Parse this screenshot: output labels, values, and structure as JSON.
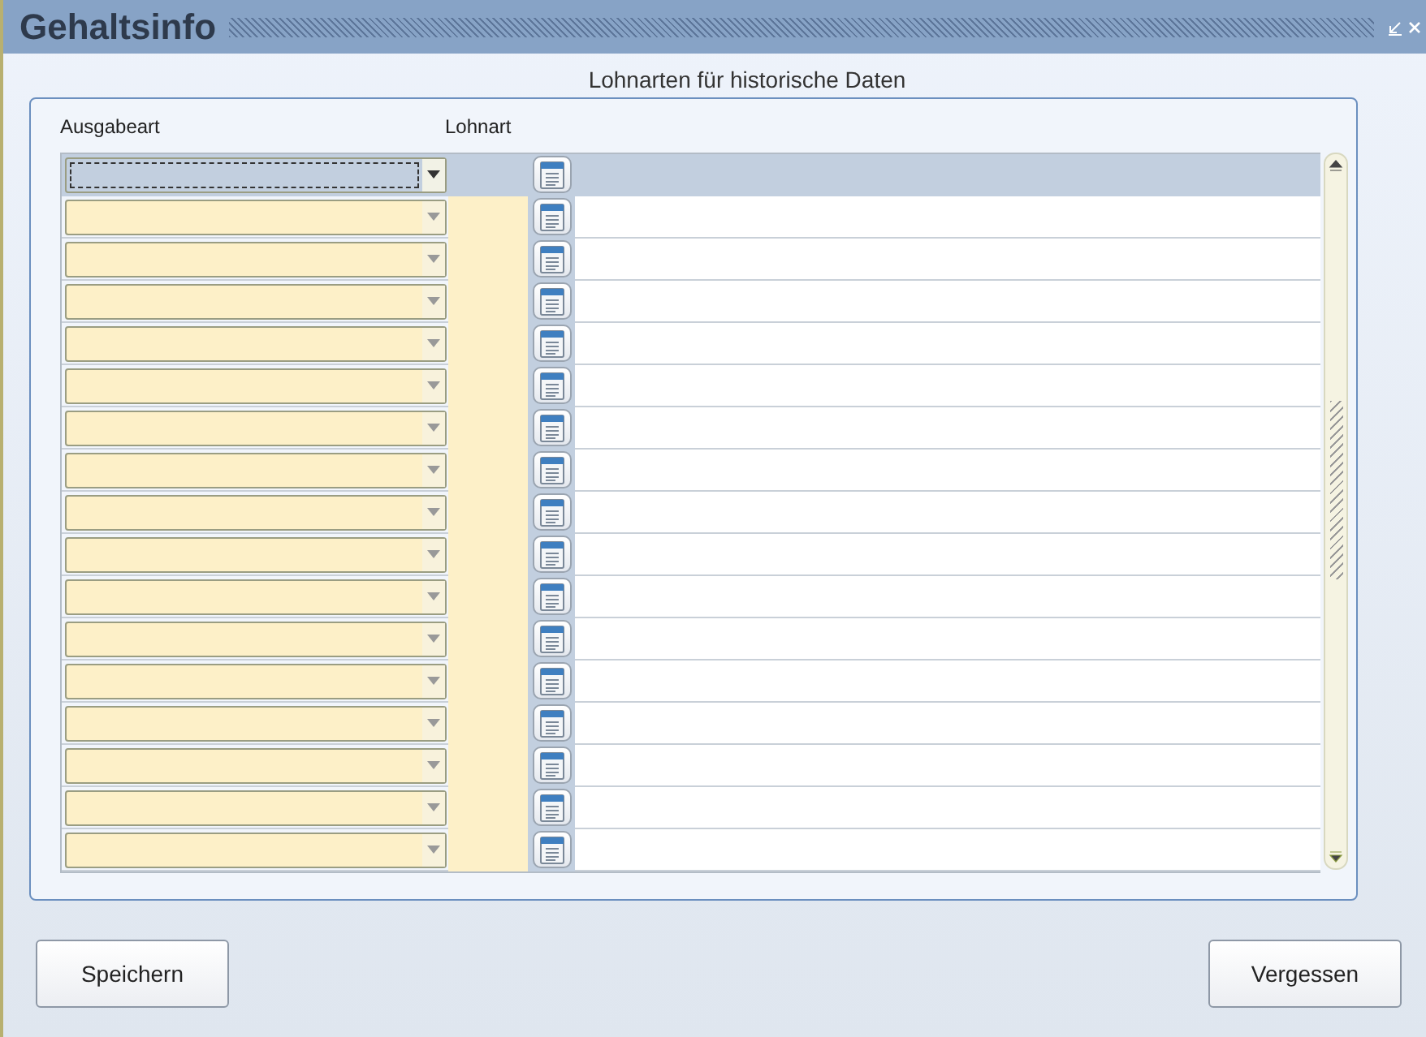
{
  "window": {
    "title": "Gehaltsinfo"
  },
  "section_title": "Lohnarten für historische Daten",
  "table": {
    "columns": [
      "Ausgabeart",
      "Lohnart"
    ],
    "rows": [
      {
        "selected": true
      },
      {
        "selected": false
      },
      {
        "selected": false
      },
      {
        "selected": false
      },
      {
        "selected": false
      },
      {
        "selected": false
      },
      {
        "selected": false
      },
      {
        "selected": false
      },
      {
        "selected": false
      },
      {
        "selected": false
      },
      {
        "selected": false
      },
      {
        "selected": false
      },
      {
        "selected": false
      },
      {
        "selected": false
      },
      {
        "selected": false
      },
      {
        "selected": false
      },
      {
        "selected": false
      }
    ]
  },
  "buttons": [
    "Speichern",
    "Vergessen"
  ]
}
